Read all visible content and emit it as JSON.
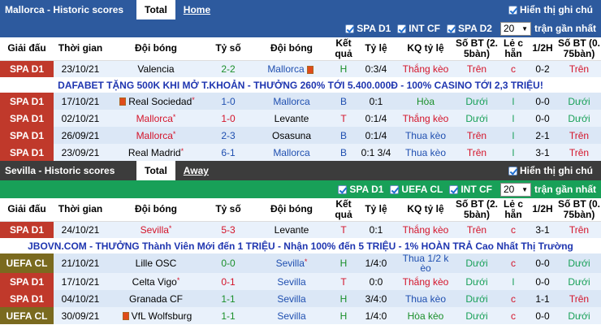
{
  "s1": {
    "title": "Mallorca - Historic scores",
    "tab_active": "Total",
    "tab_link": "Home",
    "show_notes": "Hiển thị ghi chú",
    "filters": [
      "SPA D1",
      "INT CF",
      "SPA D2"
    ],
    "select_value": "20",
    "recent_label": "trận gần nhất",
    "headers": [
      "Giải đấu",
      "Thời gian",
      "Đội bóng",
      "Tỷ số",
      "Đội bóng",
      "Kết quả",
      "Tỷ lệ",
      "KQ tỷ lệ",
      "Số BT (2. 5bàn)",
      "Lẻ c hẵn",
      "1/2H",
      "Số BT (0. 75bàn)"
    ],
    "ad": "DAFABET TẶNG 500K KHI MỞ T.KHOẢN - THƯỞNG 260% TỚI 5.400.000Đ - 100% CASINO TỚI 2,3 TRIỆU!",
    "rows": [
      {
        "league": "SPA D1",
        "date": "23/10/21",
        "home": "Valencia",
        "score": "2-2",
        "away": "Mallorca",
        "res": "H",
        "odds": "0:3/4",
        "kq": "Thắng kèo",
        "bt": "Trên",
        "lc": "c",
        "half": "0-2",
        "bt2": "Trên"
      },
      {
        "league": "SPA D1",
        "date": "17/10/21",
        "home": "Real Sociedad",
        "score": "1-0",
        "away": "Mallorca",
        "res": "B",
        "odds": "0:1",
        "kq": "Hòa",
        "bt": "Dưới",
        "lc": "l",
        "half": "0-0",
        "bt2": "Dưới"
      },
      {
        "league": "SPA D1",
        "date": "02/10/21",
        "home": "Mallorca",
        "score": "1-0",
        "away": "Levante",
        "res": "T",
        "odds": "0:1/4",
        "kq": "Thắng kèo",
        "bt": "Dưới",
        "lc": "l",
        "half": "0-0",
        "bt2": "Dưới"
      },
      {
        "league": "SPA D1",
        "date": "26/09/21",
        "home": "Mallorca",
        "score": "2-3",
        "away": "Osasuna",
        "res": "B",
        "odds": "0:1/4",
        "kq": "Thua kèo",
        "bt": "Trên",
        "lc": "l",
        "half": "2-1",
        "bt2": "Trên"
      },
      {
        "league": "SPA D1",
        "date": "23/09/21",
        "home": "Real Madrid",
        "score": "6-1",
        "away": "Mallorca",
        "res": "B",
        "odds": "0:1 3/4",
        "kq": "Thua kèo",
        "bt": "Trên",
        "lc": "l",
        "half": "3-1",
        "bt2": "Trên"
      }
    ]
  },
  "s2": {
    "title": "Sevilla - Historic scores",
    "tab_active": "Total",
    "tab_link": "Away",
    "show_notes": "Hiển thị ghi chú",
    "filters": [
      "SPA D1",
      "UEFA CL",
      "INT CF"
    ],
    "select_value": "20",
    "recent_label": "trận gần nhất",
    "headers": [
      "Giải đấu",
      "Thời gian",
      "Đội bóng",
      "Tỷ số",
      "Đội bóng",
      "Kết quả",
      "Tỷ lệ",
      "KQ tỷ lệ",
      "Số BT (2. 5bàn)",
      "Lẻ c hẵn",
      "1/2H",
      "Số BT (0. 75bàn)"
    ],
    "ad": "JBOVN.COM - THƯỞNG Thành Viên Mới đến 1 TRIỆU - Nhận 100% đến 5 TRIỆU - 1% HOÀN TRẢ Cao Nhất Thị Trường",
    "rows": [
      {
        "league": "SPA D1",
        "date": "24/10/21",
        "home": "Sevilla",
        "score": "5-3",
        "away": "Levante",
        "res": "T",
        "odds": "0:1",
        "kq": "Thắng kèo",
        "bt": "Trên",
        "lc": "c",
        "half": "3-1",
        "bt2": "Trên"
      },
      {
        "league": "UEFA CL",
        "date": "21/10/21",
        "home": "Lille OSC",
        "score": "0-0",
        "away": "Sevilla",
        "res": "H",
        "odds": "1/4:0",
        "kq": "Thua 1/2 k èo",
        "bt": "Dưới",
        "lc": "c",
        "half": "0-0",
        "bt2": "Dưới"
      },
      {
        "league": "SPA D1",
        "date": "17/10/21",
        "home": "Celta Vigo",
        "score": "0-1",
        "away": "Sevilla",
        "res": "T",
        "odds": "0:0",
        "kq": "Thắng kèo",
        "bt": "Dưới",
        "lc": "l",
        "half": "0-0",
        "bt2": "Dưới"
      },
      {
        "league": "SPA D1",
        "date": "04/10/21",
        "home": "Granada CF",
        "score": "1-1",
        "away": "Sevilla",
        "res": "H",
        "odds": "3/4:0",
        "kq": "Thua kèo",
        "bt": "Dưới",
        "lc": "c",
        "half": "1-1",
        "bt2": "Trên"
      },
      {
        "league": "UEFA CL",
        "date": "30/09/21",
        "home": "VfL Wolfsburg",
        "score": "1-1",
        "away": "Sevilla",
        "res": "H",
        "odds": "1/4:0",
        "kq": "Hòa kèo",
        "bt": "Dưới",
        "lc": "c",
        "half": "0-0",
        "bt2": "Dưới"
      }
    ]
  }
}
